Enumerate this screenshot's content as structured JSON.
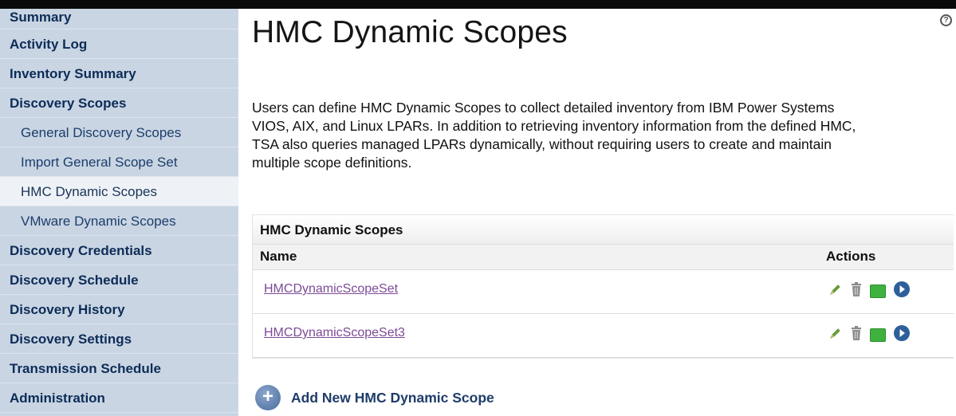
{
  "sidebar": {
    "items": [
      {
        "label": "Summary"
      },
      {
        "label": "Activity Log"
      },
      {
        "label": "Inventory Summary"
      },
      {
        "label": "Discovery Scopes"
      },
      {
        "label": "General Discovery Scopes"
      },
      {
        "label": "Import General Scope Set"
      },
      {
        "label": "HMC Dynamic Scopes"
      },
      {
        "label": "VMware Dynamic Scopes"
      },
      {
        "label": "Discovery Credentials"
      },
      {
        "label": "Discovery Schedule"
      },
      {
        "label": "Discovery History"
      },
      {
        "label": "Discovery Settings"
      },
      {
        "label": "Transmission Schedule"
      },
      {
        "label": "Administration"
      }
    ]
  },
  "main": {
    "title": "HMC Dynamic Scopes",
    "description_lines": [
      "Users can define HMC Dynamic Scopes to collect detailed inventory from IBM Power Systems",
      "VIOS, AIX, and Linux LPARs. In addition to retrieving inventory information from the defined HMC,",
      "TSA also queries managed LPARs dynamically, without requiring users to create and maintain",
      "multiple scope definitions."
    ],
    "table": {
      "caption": "HMC Dynamic Scopes",
      "col_name": "Name",
      "col_actions": "Actions",
      "rows": [
        {
          "name": "HMCDynamicScopeSet"
        },
        {
          "name": "HMCDynamicScopeSet3"
        }
      ]
    },
    "add_label": "Add New HMC Dynamic Scope",
    "add_symbol": "+",
    "help_symbol": "?"
  },
  "icons": {
    "edit": "pencil-icon",
    "delete": "trash-icon",
    "run": "green-square-icon",
    "go": "arrow-circle-icon",
    "add": "plus-circle-icon",
    "help": "help-icon"
  },
  "colors": {
    "sidebar_bg": "#c9d5e3",
    "nav_text": "#0d2c57",
    "link": "#7d4a97",
    "accent_green": "#3fb13f",
    "accent_blue": "#2d5f9a"
  }
}
